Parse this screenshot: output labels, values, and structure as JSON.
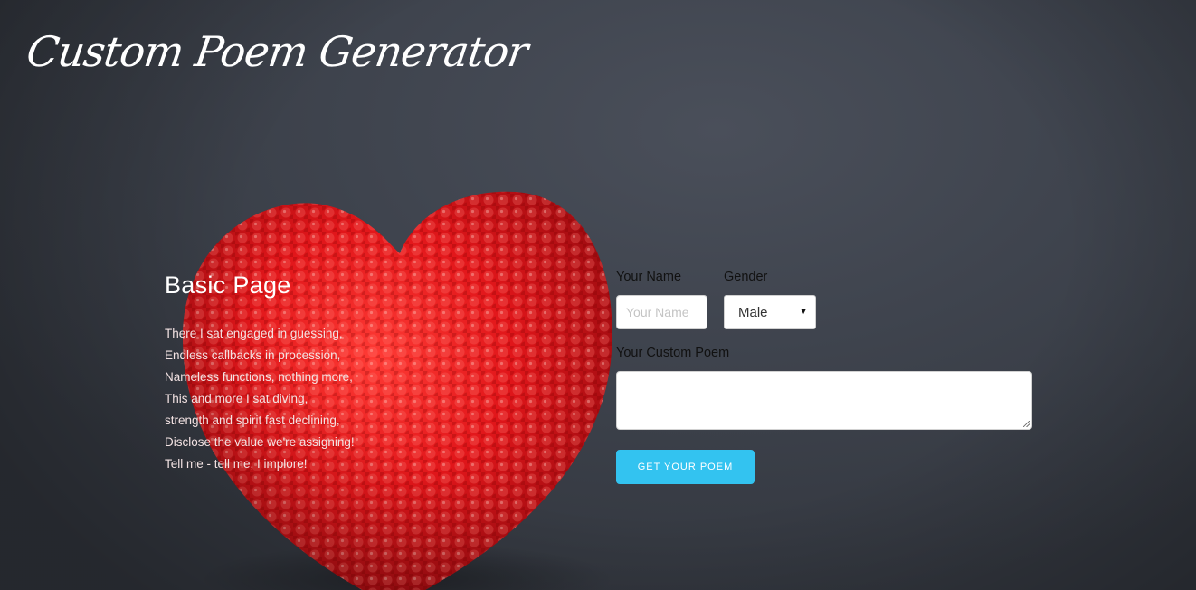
{
  "header": {
    "site_title": "Custom Poem Generator"
  },
  "intro": {
    "heading": "Basic Page",
    "poem_lines": [
      "There I sat engaged in guessing,",
      "Endless callbacks in procession,",
      "Nameless functions, nothing more,",
      "This and more I sat diving,",
      "strength and spirit fast declining,",
      "Disclose the value we're assigning!",
      "Tell me - tell me, I implore!"
    ]
  },
  "form": {
    "name_label": "Your Name",
    "name_placeholder": "Your Name",
    "name_value": "",
    "gender_label": "Gender",
    "gender_selected": "Male",
    "poem_label": "Your Custom Poem",
    "poem_value": "",
    "submit_label": "Get Your Poem"
  },
  "colors": {
    "background": "#3f444e",
    "button": "#33c3f0",
    "heart": "#e0191c"
  },
  "icons": {
    "select_arrow": "triangle-down-icon",
    "resize_handle": "resize-grip-icon"
  }
}
